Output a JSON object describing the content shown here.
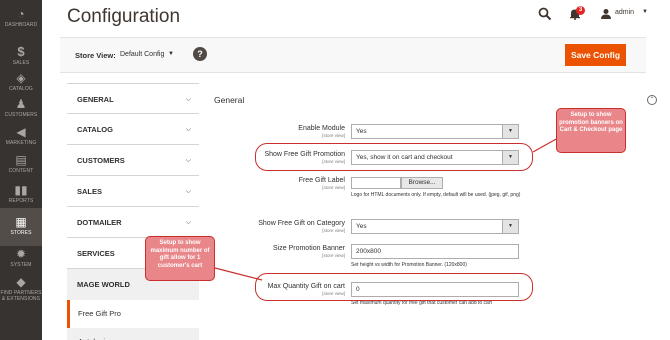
{
  "nav": {
    "items": [
      {
        "label": "DASHBOARD",
        "icon": "dashboard-icon"
      },
      {
        "label": "SALES",
        "icon": "dollar-icon"
      },
      {
        "label": "CATALOG",
        "icon": "box-icon"
      },
      {
        "label": "CUSTOMERS",
        "icon": "person-icon"
      },
      {
        "label": "MARKETING",
        "icon": "megaphone-icon"
      },
      {
        "label": "CONTENT",
        "icon": "content-icon"
      },
      {
        "label": "REPORTS",
        "icon": "bar-chart-icon"
      },
      {
        "label": "STORES",
        "icon": "store-icon"
      },
      {
        "label": "SYSTEM",
        "icon": "gear-icon"
      },
      {
        "label": "FIND PARTNERS & EXTENSIONS",
        "icon": "puzzle-icon"
      }
    ]
  },
  "header": {
    "title": "Configuration",
    "notification_count": "3",
    "user": "admin"
  },
  "store_bar": {
    "label": "Store View:",
    "value": "Default Config",
    "help": "?",
    "save_label": "Save Config"
  },
  "tabs": [
    {
      "label": "GENERAL"
    },
    {
      "label": "CATALOG"
    },
    {
      "label": "CUSTOMERS"
    },
    {
      "label": "SALES"
    },
    {
      "label": "DOTMAILER"
    },
    {
      "label": "SERVICES"
    },
    {
      "label": "MAGE WORLD"
    }
  ],
  "subtabs": [
    {
      "label": "Free Gift Pro"
    },
    {
      "label": "Autologin"
    }
  ],
  "section": {
    "title": "General",
    "scope": "[store view]"
  },
  "fields": {
    "enable_module": {
      "label": "Enable Module",
      "value": "Yes"
    },
    "show_promotion": {
      "label": "Show Free Gift Promotion",
      "value": "Yes, show it on cart and checkout"
    },
    "gift_label": {
      "label": "Free Gift Label",
      "browse": "Browse...",
      "note": "Logo for HTML documents only. If empty, default will be used. (jpeg, gif, png)"
    },
    "show_on_category": {
      "label": "Show Free Gift on Category",
      "value": "Yes"
    },
    "banner_size": {
      "label": "Size Promotion Banner",
      "value": "200x800",
      "note": "Set height vs width for Promotion Banner. (120x800)"
    },
    "max_qty": {
      "label": "Max Quantity Gift on cart",
      "value": "0",
      "note": "Set maximum quantity for free gift that customer can add to cart"
    }
  },
  "callouts": {
    "banners": "Setup to show promotion banners on Cart & Checkout page",
    "max_gift": "Setup to show maximum number of gift allow for 1 customer's cart"
  },
  "colors": {
    "nav_bg": "#373330",
    "accent": "#eb5202",
    "highlight": "#c9302c",
    "callout_bg": "#e8868a"
  }
}
